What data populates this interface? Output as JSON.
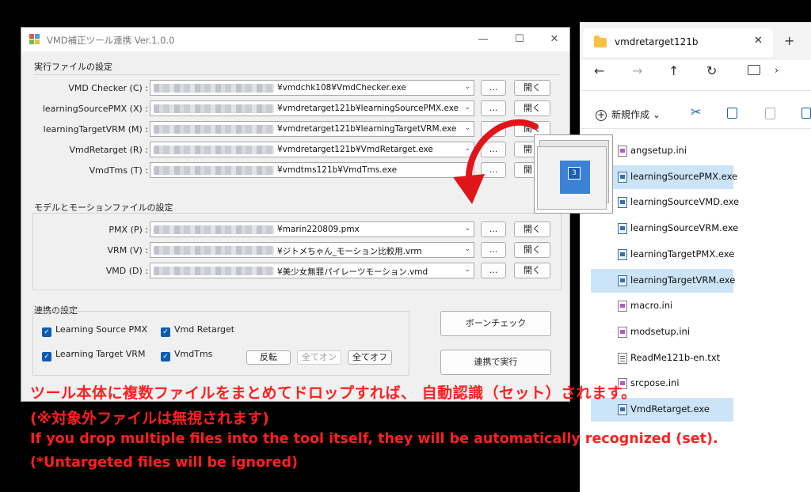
{
  "tool_window": {
    "title": "VMD補正ツール連携 Ver.1.0.0",
    "controls": {
      "minimize": "—",
      "maximize": "☐",
      "close": "✕"
    },
    "exec_group_title": "実行ファイルの設定",
    "exec_rows": [
      {
        "label": "VMD Checker (C) :",
        "path": "¥vmdchk108¥VmdChecker.exe"
      },
      {
        "label": "learningSourcePMX (X) :",
        "path": "¥vmdretarget121b¥learningSourcePMX.exe"
      },
      {
        "label": "learningTargetVRM (M) :",
        "path": "¥vmdretarget121b¥learningTargetVRM.exe"
      },
      {
        "label": "VmdRetarget (R) :",
        "path": "¥vmdretarget121b¥VmdRetarget.exe"
      },
      {
        "label": "VmdTms (T) :",
        "path": "¥vmdtms121b¥VmdTms.exe"
      }
    ],
    "model_group_title": "モデルとモーションファイルの設定",
    "model_rows": [
      {
        "label": "PMX (P) :",
        "path": "¥marin220809.pmx"
      },
      {
        "label": "VRM (V) :",
        "path": "¥ジトメちゃん_モーション比較用.vrm"
      },
      {
        "label": "VMD (D) :",
        "path": "¥美少女無罪パイレーツモーション.vmd"
      }
    ],
    "browse_label": "...",
    "open_label": "開く",
    "link_group_title": "連携の設定",
    "checkboxes": [
      {
        "label": "Learning Source PMX",
        "checked": true
      },
      {
        "label": "Vmd Retarget",
        "checked": true
      },
      {
        "label": "Learning Target VRM",
        "checked": true
      },
      {
        "label": "VmdTms",
        "checked": true
      }
    ],
    "invert_label": "反転",
    "all_on_label": "全てオン",
    "all_off_label": "全てオフ",
    "bone_check_label": "ボーンチェック",
    "run_label": "連携で実行"
  },
  "explorer": {
    "tab_title": "vmdretarget121b",
    "tab_close": "✕",
    "new_tab": "+",
    "new_label": "新規作成",
    "files": [
      {
        "name": "angsetup.ini",
        "type": "ini",
        "selected": false
      },
      {
        "name": "learningSourcePMX.exe",
        "type": "exe",
        "selected": true
      },
      {
        "name": "learningSourceVMD.exe",
        "type": "exe",
        "selected": false
      },
      {
        "name": "learningSourceVRM.exe",
        "type": "exe",
        "selected": false
      },
      {
        "name": "learningTargetPMX.exe",
        "type": "exe",
        "selected": false
      },
      {
        "name": "learningTargetVRM.exe",
        "type": "exe",
        "selected": true
      },
      {
        "name": "macro.ini",
        "type": "ini",
        "selected": false
      },
      {
        "name": "modsetup.ini",
        "type": "ini",
        "selected": false
      },
      {
        "name": "ReadMe121b-en.txt",
        "type": "txt",
        "selected": false
      },
      {
        "name": "srcpose.ini",
        "type": "ini",
        "selected": false
      },
      {
        "name": "VmdRetarget.exe",
        "type": "exe",
        "selected": true
      }
    ]
  },
  "drag_ghost": {
    "count": "3"
  },
  "captions": {
    "jp_line1": "ツール本体に複数ファイルをまとめてドロップすれば、 自動認識（セット）されます。",
    "jp_line2": "(※対象外ファイルは無視されます)",
    "en_line1": "If you drop multiple files into the tool itself, they will be automatically recognized (set).",
    "en_line2": "(*Untargeted files will be ignored)"
  },
  "colors": {
    "caption": "#ff1f1f",
    "arrow": "#e0151b",
    "selection": "#cce4f7",
    "checkbox": "#0b5cad"
  }
}
